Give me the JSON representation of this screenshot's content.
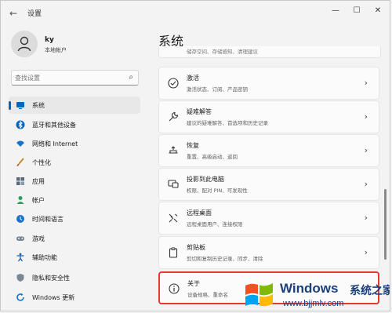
{
  "window": {
    "title": "设置",
    "back_glyph": "←",
    "minimize_glyph": "—",
    "maximize_glyph": "☐",
    "close_glyph": "✕"
  },
  "user": {
    "name": "ky",
    "account_type": "本地帐户"
  },
  "search": {
    "placeholder": "查找设置",
    "icon": "search-icon"
  },
  "sidebar": {
    "items": [
      {
        "label": "系统",
        "icon": "monitor-icon",
        "active": true
      },
      {
        "label": "蓝牙和其他设备",
        "icon": "bluetooth-icon"
      },
      {
        "label": "网络和 Internet",
        "icon": "wifi-icon"
      },
      {
        "label": "个性化",
        "icon": "brush-icon"
      },
      {
        "label": "应用",
        "icon": "apps-icon"
      },
      {
        "label": "帐户",
        "icon": "person-icon"
      },
      {
        "label": "时间和语言",
        "icon": "globe-clock-icon"
      },
      {
        "label": "游戏",
        "icon": "gamepad-icon"
      },
      {
        "label": "辅助功能",
        "icon": "accessibility-icon"
      },
      {
        "label": "隐私和安全性",
        "icon": "shield-icon"
      },
      {
        "label": "Windows 更新",
        "icon": "update-icon"
      }
    ]
  },
  "main": {
    "title": "系统",
    "cut_row_text": "储存空间、存储感知、清理建议",
    "cards": [
      {
        "title": "激活",
        "subtitle": "激活状态、订阅、产品密钥",
        "icon": "activation-icon"
      },
      {
        "title": "疑难解答",
        "subtitle": "建议的疑难解答、首选项和历史记录",
        "icon": "wrench-icon"
      },
      {
        "title": "恢复",
        "subtitle": "重置、高级启动、返回",
        "icon": "recovery-icon"
      },
      {
        "title": "投影到此电脑",
        "subtitle": "权限、配对 PIN、可发现性",
        "icon": "projection-icon"
      },
      {
        "title": "远程桌面",
        "subtitle": "远程桌面用户、连接权限",
        "icon": "remote-desktop-icon"
      },
      {
        "title": "剪贴板",
        "subtitle": "剪切和复制历史记录、同步、清除",
        "icon": "clipboard-icon"
      },
      {
        "title": "关于",
        "subtitle": "设备规格、重命名",
        "icon": "info-icon",
        "highlighted": true
      }
    ],
    "chevron_glyph": "›"
  },
  "watermark": {
    "brand": "Windows",
    "brand_cn": "系统之家",
    "url": "www.bjjmlv.com",
    "colors": [
      "#f25022",
      "#7fba00",
      "#00a4ef",
      "#ffb900"
    ]
  },
  "colors": {
    "accent": "#0067c0",
    "highlight": "#e23a2e"
  }
}
